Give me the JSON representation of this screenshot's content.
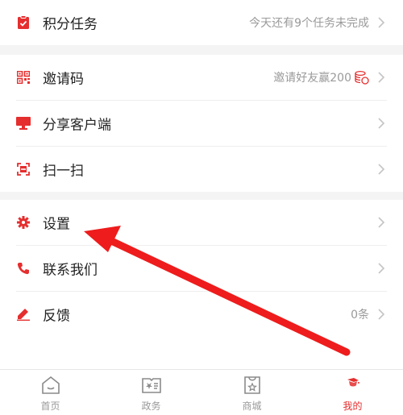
{
  "menu": {
    "points_task": {
      "label": "积分任务",
      "right_text": "今天还有9个任务未完成"
    },
    "invite_code": {
      "label": "邀请码",
      "right_text": "邀请好友赢200"
    },
    "share_client": {
      "label": "分享客户端"
    },
    "scan": {
      "label": "扫一扫"
    },
    "settings": {
      "label": "设置"
    },
    "contact_us": {
      "label": "联系我们"
    },
    "feedback": {
      "label": "反馈",
      "right_text": "0条"
    }
  },
  "tabbar": {
    "tabs": [
      {
        "label": "首页",
        "icon": "home-icon",
        "active": false
      },
      {
        "label": "政务",
        "icon": "government-affairs-icon",
        "active": false
      },
      {
        "label": "商城",
        "icon": "shopping-bag-icon",
        "active": false
      },
      {
        "label": "我的",
        "icon": "profile-icon",
        "active": true
      }
    ]
  },
  "colors": {
    "accent": "#e52e2e",
    "annotation_arrow": "#ee1c1c",
    "text": "#222222",
    "muted": "#9a9a9a",
    "section_gap": "#f4f4f4"
  },
  "annotation": {
    "type": "arrow",
    "points_to": "settings"
  }
}
